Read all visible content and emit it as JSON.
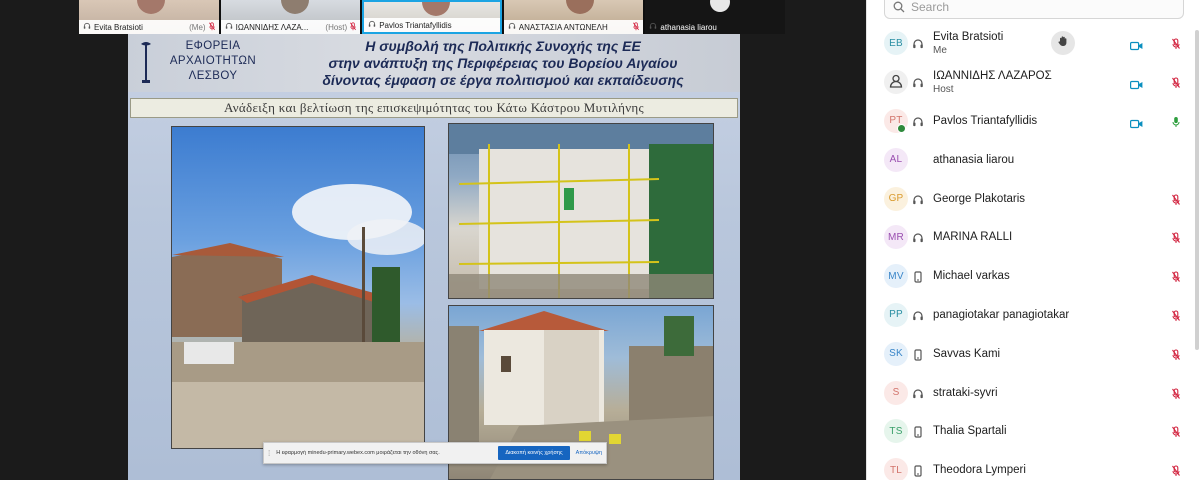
{
  "thumbnails": [
    {
      "name": "Evita Bratsioti",
      "sub": "(Me)",
      "muted": true
    },
    {
      "name": "ΙΩΑΝΝΙΔΗΣ ΛΑΖΑ...",
      "sub": "(Host)",
      "muted": true
    },
    {
      "name": "Pavlos Triantafyllidis",
      "sub": "",
      "muted": false,
      "active": true
    },
    {
      "name": "ΑΝΑΣΤΑΣΙΑ ΑΝΤΩΝΕΛΗ",
      "sub": "",
      "muted": true
    },
    {
      "name": "athanasia liarou",
      "sub": "",
      "muted": false
    }
  ],
  "slide": {
    "org_lines": [
      "ΕΦΟΡΕΙΑ",
      "ΑΡΧΑΙΟΤΗΤΩΝ",
      "ΛΕΣΒΟΥ"
    ],
    "title_lines": [
      "Η συμβολή της Πολιτικής Συνοχής της ΕΕ",
      "στην ανάπτυξη της Περιφέρειας του Βορείου Αιγαίου",
      "δίνοντας έμφαση σε έργα πολιτισμού και εκπαίδευσης"
    ],
    "subtitle": "Ανάδειξη και βελτίωση της επισκεψιμότητας του Κάτω Κάστρου Μυτιλήνης"
  },
  "share_banner": {
    "text": "Η εφαρμογή minedu-primary.webex.com μοιράζεται την οθόνη σας.",
    "stop_label": "Διακοπή κοινής χρήσης",
    "hide_label": "Απόκρυψη"
  },
  "panel": {
    "search_placeholder": "Search",
    "participants": [
      {
        "initials": "EB",
        "name": "Evita Bratsioti",
        "sub": "Me",
        "avatar_color": "#2a8fa3",
        "avatar_bg": "#e6f3f6",
        "device": "audio",
        "video": true,
        "mic": "muted",
        "hand": true
      },
      {
        "initials": "",
        "name": "ΙΩΑΝΝΙΔΗΣ ΛΑΖΑΡΟΣ",
        "sub": "Host",
        "avatar_color": "#555555",
        "avatar_bg": "#f0f0f0",
        "device": "audio",
        "video": true,
        "mic": "muted",
        "icon_avatar": true
      },
      {
        "initials": "PT",
        "name": "Pavlos Triantafyllidis",
        "sub": "",
        "avatar_color": "#d2736b",
        "avatar_bg": "#fbe9e7",
        "device": "audio",
        "video": true,
        "mic": "active",
        "badge": true
      },
      {
        "initials": "AL",
        "name": "athanasia liarou",
        "sub": "",
        "avatar_color": "#9a4fb0",
        "avatar_bg": "#f4e8f7",
        "device": "none",
        "video": false,
        "mic": "none"
      },
      {
        "initials": "GP",
        "name": "George Plakotaris",
        "sub": "",
        "avatar_color": "#d99a2c",
        "avatar_bg": "#fbf1de",
        "device": "audio",
        "video": false,
        "mic": "muted"
      },
      {
        "initials": "MR",
        "name": "MARINA RALLI",
        "sub": "",
        "avatar_color": "#9a4fb0",
        "avatar_bg": "#f4e8f7",
        "device": "audio",
        "video": false,
        "mic": "muted"
      },
      {
        "initials": "MV",
        "name": "Michael varkas",
        "sub": "",
        "avatar_color": "#3a86c9",
        "avatar_bg": "#e5f0fa",
        "device": "phone",
        "video": false,
        "mic": "muted"
      },
      {
        "initials": "PP",
        "name": "panagiotakar panagiotakar",
        "sub": "",
        "avatar_color": "#2a8fa3",
        "avatar_bg": "#e6f3f6",
        "device": "audio",
        "video": false,
        "mic": "muted"
      },
      {
        "initials": "SK",
        "name": "Savvas Kami",
        "sub": "",
        "avatar_color": "#3a86c9",
        "avatar_bg": "#e5f0fa",
        "device": "phone",
        "video": false,
        "mic": "muted"
      },
      {
        "initials": "S",
        "name": "strataki-syvri",
        "sub": "",
        "avatar_color": "#d2736b",
        "avatar_bg": "#fbe9e7",
        "device": "audio",
        "video": false,
        "mic": "muted"
      },
      {
        "initials": "TS",
        "name": "Thalia Spartali",
        "sub": "",
        "avatar_color": "#3aa06a",
        "avatar_bg": "#e6f5ec",
        "device": "phone",
        "video": false,
        "mic": "muted"
      },
      {
        "initials": "TL",
        "name": "Theodora Lymperi",
        "sub": "",
        "avatar_color": "#d2736b",
        "avatar_bg": "#fbe9e7",
        "device": "phone",
        "video": false,
        "mic": "muted"
      }
    ]
  },
  "colors": {
    "accent_blue": "#1665c0",
    "active_tile_border": "#1ba4e3",
    "muted_red": "#d2233f",
    "mic_green": "#2e9e3e",
    "video_teal": "#0a8fbf"
  }
}
